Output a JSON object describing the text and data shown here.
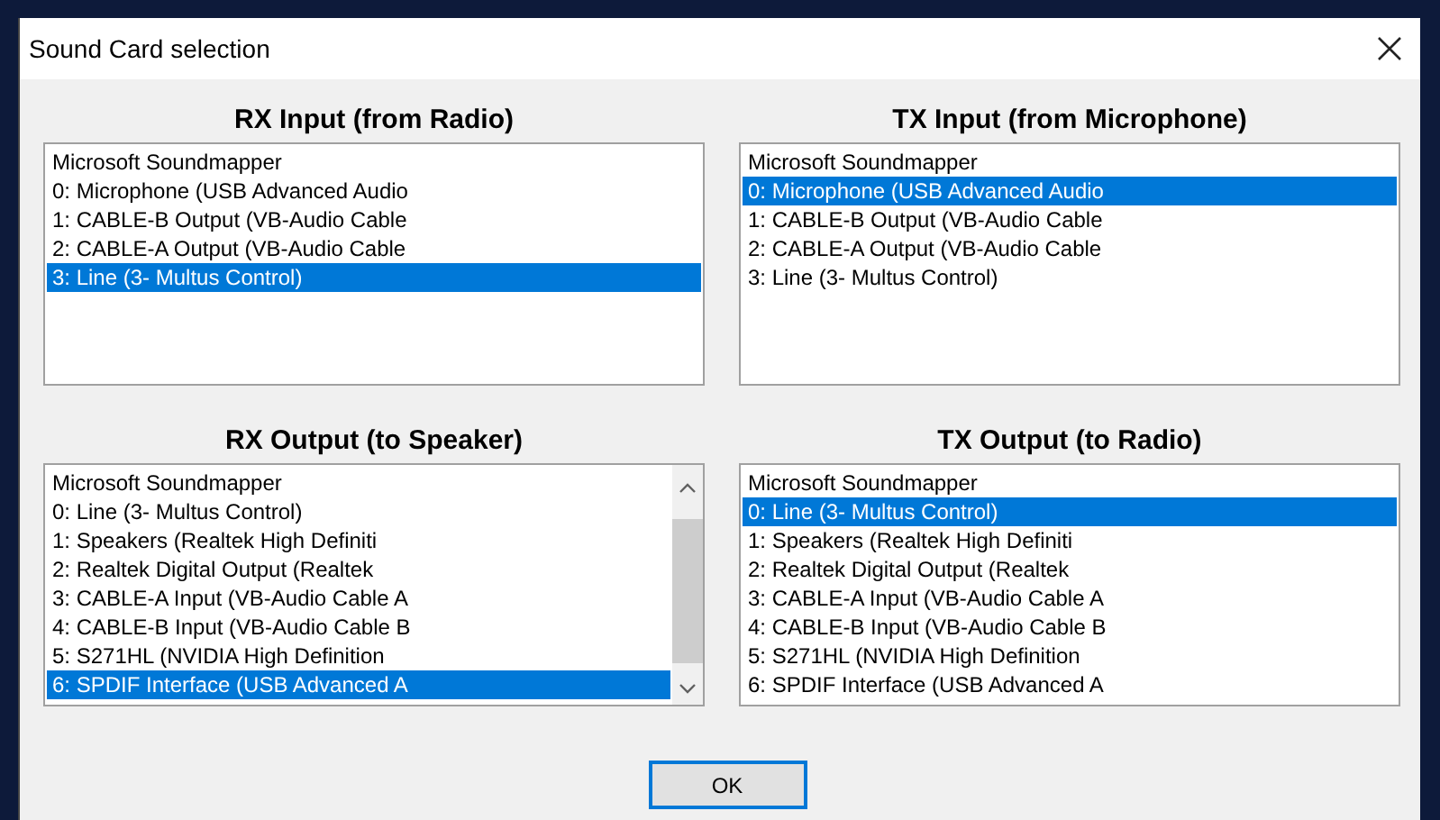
{
  "window": {
    "title": "Sound Card selection"
  },
  "panels": [
    {
      "title": "RX Input (from Radio)",
      "scrollbar": false,
      "items": [
        {
          "label": "Microsoft Soundmapper",
          "selected": false
        },
        {
          "label": "0: Microphone (USB Advanced Audio",
          "selected": false
        },
        {
          "label": "1: CABLE-B Output (VB-Audio Cable",
          "selected": false
        },
        {
          "label": "2: CABLE-A Output (VB-Audio Cable",
          "selected": false
        },
        {
          "label": "3: Line (3- Multus Control)",
          "selected": true
        }
      ]
    },
    {
      "title": "TX Input (from Microphone)",
      "scrollbar": false,
      "items": [
        {
          "label": "Microsoft Soundmapper",
          "selected": false
        },
        {
          "label": "0: Microphone (USB Advanced Audio",
          "selected": true
        },
        {
          "label": "1: CABLE-B Output (VB-Audio Cable",
          "selected": false
        },
        {
          "label": "2: CABLE-A Output (VB-Audio Cable",
          "selected": false
        },
        {
          "label": "3: Line (3- Multus Control)",
          "selected": false
        }
      ]
    },
    {
      "title": "RX Output (to Speaker)",
      "scrollbar": true,
      "items": [
        {
          "label": "Microsoft Soundmapper",
          "selected": false
        },
        {
          "label": "0: Line (3- Multus Control)",
          "selected": false
        },
        {
          "label": "1: Speakers (Realtek High Definiti",
          "selected": false
        },
        {
          "label": "2: Realtek Digital Output (Realtek",
          "selected": false
        },
        {
          "label": "3: CABLE-A Input (VB-Audio Cable A",
          "selected": false
        },
        {
          "label": "4: CABLE-B Input (VB-Audio Cable B",
          "selected": false
        },
        {
          "label": "5: S271HL (NVIDIA High Definition",
          "selected": false
        },
        {
          "label": "6: SPDIF Interface (USB Advanced A",
          "selected": true
        }
      ]
    },
    {
      "title": "TX Output (to Radio)",
      "scrollbar": false,
      "items": [
        {
          "label": "Microsoft Soundmapper",
          "selected": false
        },
        {
          "label": "0: Line (3- Multus Control)",
          "selected": true
        },
        {
          "label": "1: Speakers (Realtek High Definiti",
          "selected": false
        },
        {
          "label": "2: Realtek Digital Output (Realtek",
          "selected": false
        },
        {
          "label": "3: CABLE-A Input (VB-Audio Cable A",
          "selected": false
        },
        {
          "label": "4: CABLE-B Input (VB-Audio Cable B",
          "selected": false
        },
        {
          "label": "5: S271HL (NVIDIA High Definition",
          "selected": false
        },
        {
          "label": "6: SPDIF Interface (USB Advanced A",
          "selected": false
        }
      ]
    }
  ],
  "buttons": [
    {
      "label": "OK"
    }
  ]
}
